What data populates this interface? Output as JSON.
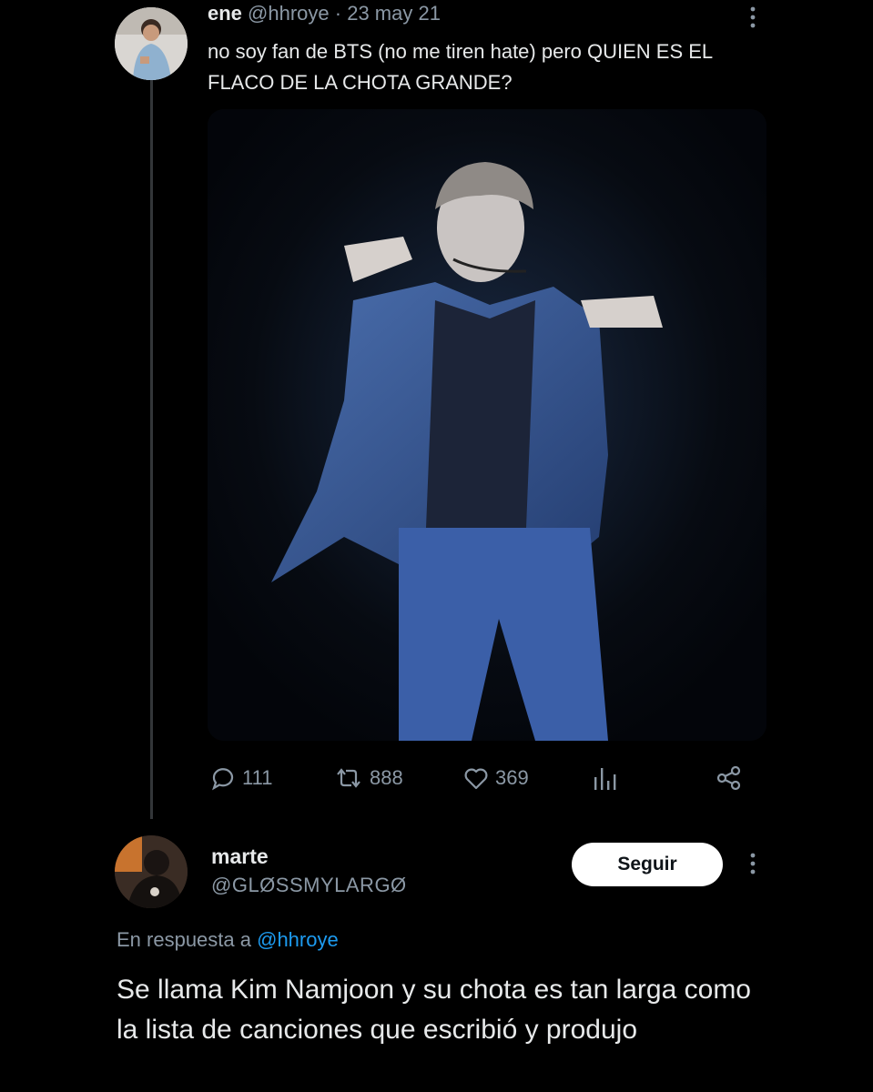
{
  "tweet": {
    "author_name": "ene",
    "author_handle": "@hhroye",
    "date": "· 23 may 21",
    "text": "no soy fan de BTS (no me tiren hate) pero QUIEN ES EL FLACO DE LA CHOTA GRANDE?",
    "stats": {
      "replies": "111",
      "retweets": "888",
      "likes": "369"
    }
  },
  "reply": {
    "author_name": "marte",
    "author_handle": "@GLØSSMYLARGØ",
    "follow_label": "Seguir",
    "reply_to_label": "En respuesta a",
    "reply_to_handle": "@hhroye",
    "text": "Se llama Kim Namjoon y su chota es tan larga como la lista de canciones que escribió y produjo"
  },
  "icons": {
    "more": "more-vertical-icon",
    "reply": "speech-bubble-icon",
    "retweet": "retweet-icon",
    "like": "heart-icon",
    "views": "bar-chart-icon",
    "share": "share-icon"
  },
  "colors": {
    "background": "#000000",
    "text": "#e7e9ea",
    "muted": "#8b98a5",
    "link": "#1d9bf0",
    "follow_button": "#ffffff"
  }
}
